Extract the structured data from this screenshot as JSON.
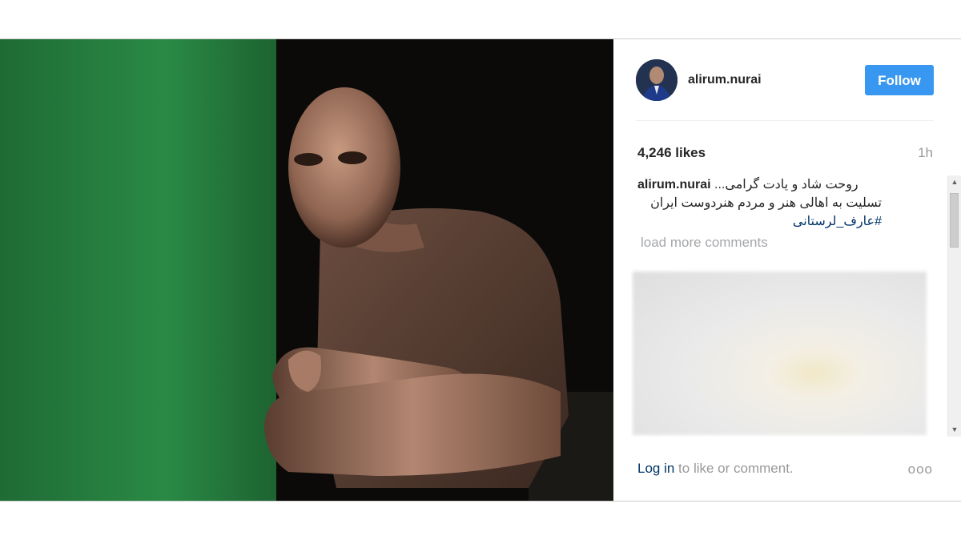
{
  "post": {
    "username": "alirum.nurai",
    "follow_label": "Follow",
    "likes": "4,246 likes",
    "time": "1h",
    "caption": {
      "username": "alirum.nurai",
      "line1": "روحت شاد و یادت گرامی...",
      "line2": "تسلیت به اهالی هنر و مردم هنردوست ایران",
      "hashtag": "#عارف_لرستانی"
    },
    "load_more": "load more comments",
    "footer": {
      "login_label": "Log in",
      "suffix": " to like or comment."
    },
    "more_icon": "ooo"
  },
  "colors": {
    "follow_button": "#3897f0",
    "link": "#003569",
    "muted_text": "#999999"
  },
  "icons": {
    "more": "more-options-icon",
    "scroll_up": "scroll-up-arrow-icon",
    "scroll_down": "scroll-down-arrow-icon"
  }
}
